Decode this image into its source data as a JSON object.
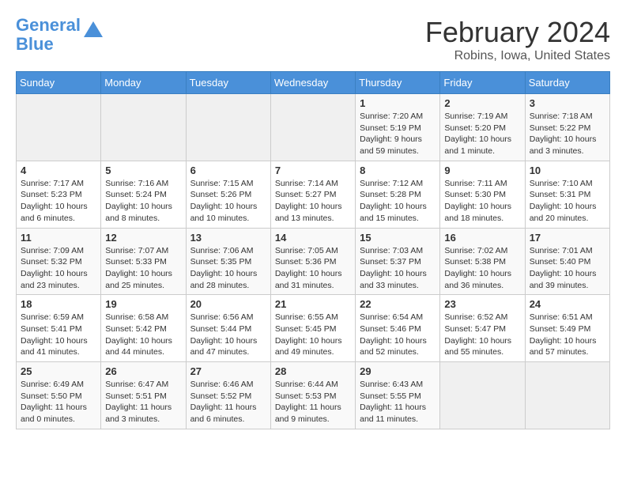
{
  "logo": {
    "line1": "General",
    "line2": "Blue"
  },
  "title": "February 2024",
  "subtitle": "Robins, Iowa, United States",
  "days_of_week": [
    "Sunday",
    "Monday",
    "Tuesday",
    "Wednesday",
    "Thursday",
    "Friday",
    "Saturday"
  ],
  "weeks": [
    [
      {
        "day": "",
        "info": ""
      },
      {
        "day": "",
        "info": ""
      },
      {
        "day": "",
        "info": ""
      },
      {
        "day": "",
        "info": ""
      },
      {
        "day": "1",
        "info": "Sunrise: 7:20 AM\nSunset: 5:19 PM\nDaylight: 9 hours\nand 59 minutes."
      },
      {
        "day": "2",
        "info": "Sunrise: 7:19 AM\nSunset: 5:20 PM\nDaylight: 10 hours\nand 1 minute."
      },
      {
        "day": "3",
        "info": "Sunrise: 7:18 AM\nSunset: 5:22 PM\nDaylight: 10 hours\nand 3 minutes."
      }
    ],
    [
      {
        "day": "4",
        "info": "Sunrise: 7:17 AM\nSunset: 5:23 PM\nDaylight: 10 hours\nand 6 minutes."
      },
      {
        "day": "5",
        "info": "Sunrise: 7:16 AM\nSunset: 5:24 PM\nDaylight: 10 hours\nand 8 minutes."
      },
      {
        "day": "6",
        "info": "Sunrise: 7:15 AM\nSunset: 5:26 PM\nDaylight: 10 hours\nand 10 minutes."
      },
      {
        "day": "7",
        "info": "Sunrise: 7:14 AM\nSunset: 5:27 PM\nDaylight: 10 hours\nand 13 minutes."
      },
      {
        "day": "8",
        "info": "Sunrise: 7:12 AM\nSunset: 5:28 PM\nDaylight: 10 hours\nand 15 minutes."
      },
      {
        "day": "9",
        "info": "Sunrise: 7:11 AM\nSunset: 5:30 PM\nDaylight: 10 hours\nand 18 minutes."
      },
      {
        "day": "10",
        "info": "Sunrise: 7:10 AM\nSunset: 5:31 PM\nDaylight: 10 hours\nand 20 minutes."
      }
    ],
    [
      {
        "day": "11",
        "info": "Sunrise: 7:09 AM\nSunset: 5:32 PM\nDaylight: 10 hours\nand 23 minutes."
      },
      {
        "day": "12",
        "info": "Sunrise: 7:07 AM\nSunset: 5:33 PM\nDaylight: 10 hours\nand 25 minutes."
      },
      {
        "day": "13",
        "info": "Sunrise: 7:06 AM\nSunset: 5:35 PM\nDaylight: 10 hours\nand 28 minutes."
      },
      {
        "day": "14",
        "info": "Sunrise: 7:05 AM\nSunset: 5:36 PM\nDaylight: 10 hours\nand 31 minutes."
      },
      {
        "day": "15",
        "info": "Sunrise: 7:03 AM\nSunset: 5:37 PM\nDaylight: 10 hours\nand 33 minutes."
      },
      {
        "day": "16",
        "info": "Sunrise: 7:02 AM\nSunset: 5:38 PM\nDaylight: 10 hours\nand 36 minutes."
      },
      {
        "day": "17",
        "info": "Sunrise: 7:01 AM\nSunset: 5:40 PM\nDaylight: 10 hours\nand 39 minutes."
      }
    ],
    [
      {
        "day": "18",
        "info": "Sunrise: 6:59 AM\nSunset: 5:41 PM\nDaylight: 10 hours\nand 41 minutes."
      },
      {
        "day": "19",
        "info": "Sunrise: 6:58 AM\nSunset: 5:42 PM\nDaylight: 10 hours\nand 44 minutes."
      },
      {
        "day": "20",
        "info": "Sunrise: 6:56 AM\nSunset: 5:44 PM\nDaylight: 10 hours\nand 47 minutes."
      },
      {
        "day": "21",
        "info": "Sunrise: 6:55 AM\nSunset: 5:45 PM\nDaylight: 10 hours\nand 49 minutes."
      },
      {
        "day": "22",
        "info": "Sunrise: 6:54 AM\nSunset: 5:46 PM\nDaylight: 10 hours\nand 52 minutes."
      },
      {
        "day": "23",
        "info": "Sunrise: 6:52 AM\nSunset: 5:47 PM\nDaylight: 10 hours\nand 55 minutes."
      },
      {
        "day": "24",
        "info": "Sunrise: 6:51 AM\nSunset: 5:49 PM\nDaylight: 10 hours\nand 57 minutes."
      }
    ],
    [
      {
        "day": "25",
        "info": "Sunrise: 6:49 AM\nSunset: 5:50 PM\nDaylight: 11 hours\nand 0 minutes."
      },
      {
        "day": "26",
        "info": "Sunrise: 6:47 AM\nSunset: 5:51 PM\nDaylight: 11 hours\nand 3 minutes."
      },
      {
        "day": "27",
        "info": "Sunrise: 6:46 AM\nSunset: 5:52 PM\nDaylight: 11 hours\nand 6 minutes."
      },
      {
        "day": "28",
        "info": "Sunrise: 6:44 AM\nSunset: 5:53 PM\nDaylight: 11 hours\nand 9 minutes."
      },
      {
        "day": "29",
        "info": "Sunrise: 6:43 AM\nSunset: 5:55 PM\nDaylight: 11 hours\nand 11 minutes."
      },
      {
        "day": "",
        "info": ""
      },
      {
        "day": "",
        "info": ""
      }
    ]
  ]
}
